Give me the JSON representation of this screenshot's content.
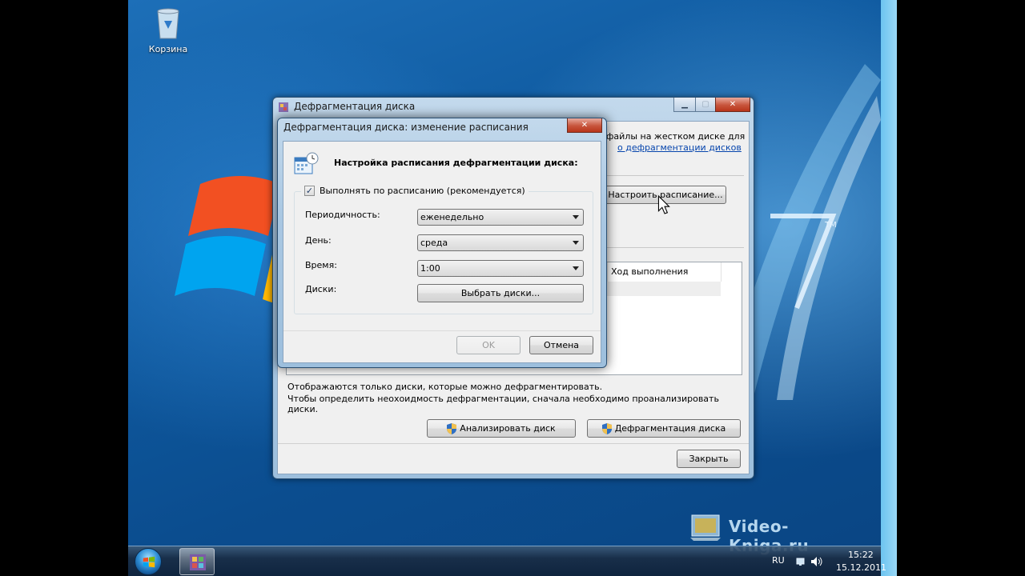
{
  "desktop": {
    "recycle_bin_label": "Корзина"
  },
  "main_window": {
    "title": "Дефрагментация диска",
    "intro_line1": "файлы на жестком диске для",
    "intro_link": "о дефрагментации дисков",
    "schedule_button": "Настроить расписание...",
    "column_progress": "Ход выполнения",
    "info_line1": "Отображаются только диски, которые можно дефрагментировать.",
    "info_line2": "Чтобы определить неохоидмость  дефрагментации, сначала необходимо проанализировать диски.",
    "analyze_button": "Анализировать диск",
    "defrag_button": "Дефрагментация диска",
    "close_button": "Закрыть"
  },
  "dialog": {
    "title": "Дефрагментация диска: изменение расписания",
    "heading": "Настройка расписания дефрагментации диска:",
    "run_on_schedule_label": "Выполнять по расписанию (рекомендуется)",
    "run_on_schedule_checked": true,
    "frequency_label": "Периодичность:",
    "frequency_value": "еженедельно",
    "day_label": "День:",
    "day_value": "среда",
    "time_label": "Время:",
    "time_value": "1:00",
    "disks_label": "Диски:",
    "select_disks_button": "Выбрать диски...",
    "ok_button": "OK",
    "cancel_button": "Отмена"
  },
  "taskbar": {
    "language": "RU",
    "time": "15:22",
    "date": "15.12.2011"
  },
  "watermark": {
    "text": "Video-Kniga.ru"
  }
}
